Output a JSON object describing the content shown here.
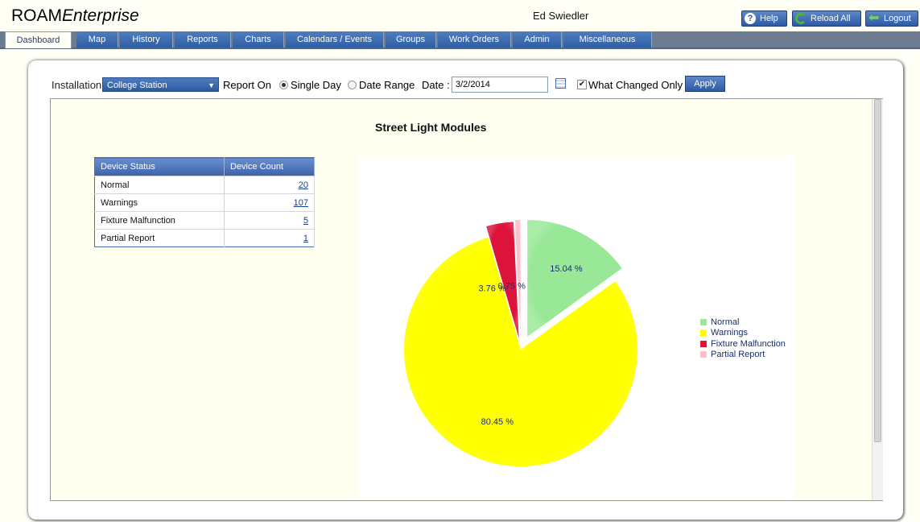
{
  "header": {
    "brand_plain": "ROAM",
    "brand_italic": "Enterprise",
    "user": "Ed Swiedler",
    "help_label": "Help",
    "reload_label": "Reload All",
    "logout_label": "Logout"
  },
  "nav": {
    "tabs": [
      "Dashboard",
      "Map",
      "History",
      "Reports",
      "Charts",
      "Calendars / Events",
      "Groups",
      "Work Orders",
      "Admin",
      "Miscellaneous"
    ],
    "active": "Dashboard"
  },
  "filters": {
    "installation_label": "Installation",
    "installation_value": "College Station",
    "report_on_label": "Report On",
    "single_day_label": "Single Day",
    "date_range_label": "Date Range",
    "single_day_selected": true,
    "date_label": "Date :",
    "date_value": "3/2/2014",
    "what_changed_label": "What Changed Only",
    "what_changed_checked": true,
    "apply_label": "Apply"
  },
  "report": {
    "title": "Street Light Modules",
    "table": {
      "headers": [
        "Device Status",
        "Device Count"
      ],
      "rows": [
        {
          "status": "Normal",
          "count": "20"
        },
        {
          "status": "Warnings",
          "count": "107"
        },
        {
          "status": "Fixture Malfunction",
          "count": "5"
        },
        {
          "status": "Partial Report",
          "count": "1"
        }
      ]
    }
  },
  "chart_data": {
    "type": "pie",
    "title": "Street Light Modules",
    "categories": [
      "Normal",
      "Warnings",
      "Fixture Malfunction",
      "Partial Report"
    ],
    "values": [
      15.04,
      80.45,
      3.76,
      0.75
    ],
    "labels": [
      "15.04 %",
      "80.45 %",
      "3.76 %",
      "0.75 %"
    ],
    "colors": [
      "#98e898",
      "#ffff00",
      "#dc143c",
      "#ffc0cb"
    ],
    "legend": "right"
  }
}
